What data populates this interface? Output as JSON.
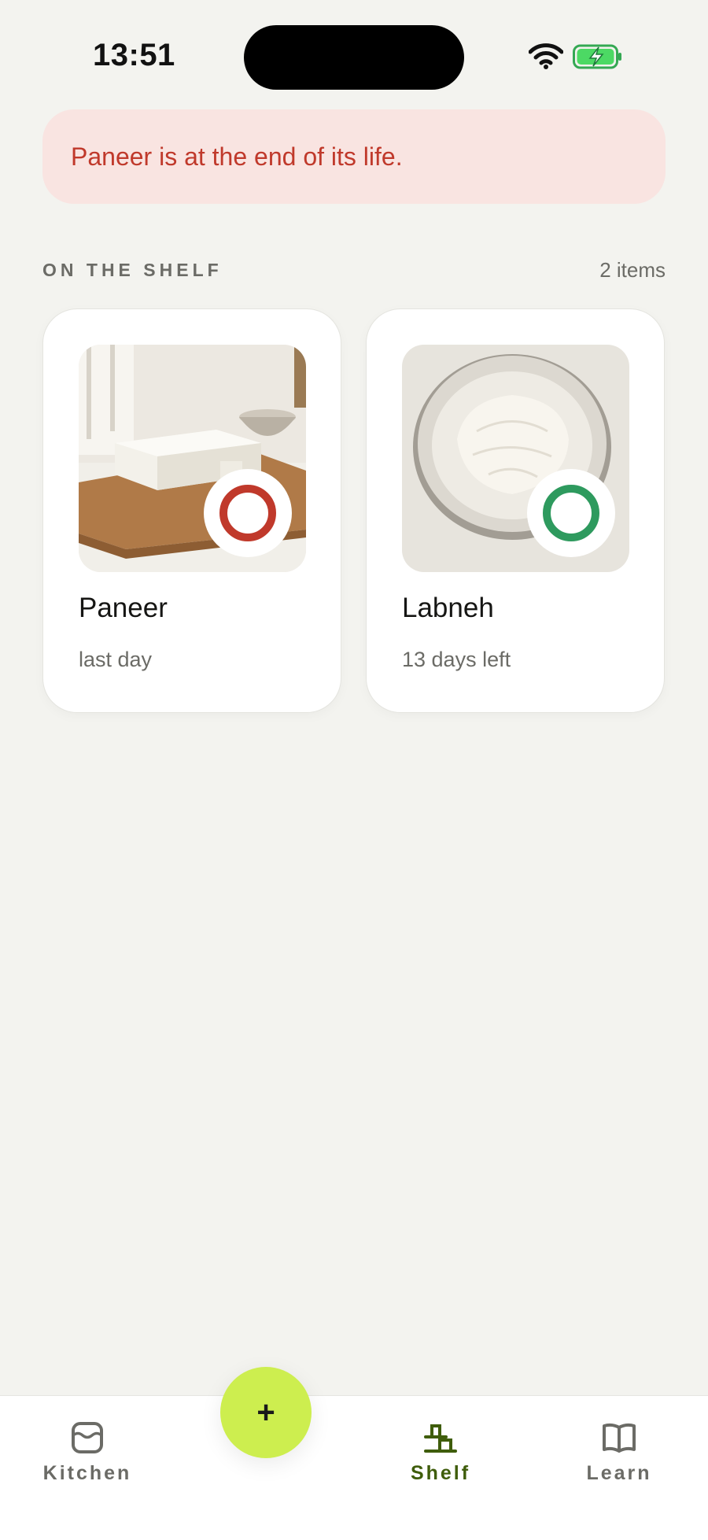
{
  "status_bar": {
    "time": "13:51"
  },
  "alert": {
    "text": "Paneer is at the end of its life.",
    "color": "#c0392b",
    "background": "#f9e4e1"
  },
  "shelf": {
    "title": "ON THE SHELF",
    "count": "2 items",
    "items": [
      {
        "name": "Paneer",
        "status": "last day",
        "status_color": "#c0392b",
        "photo_icon": "paneer-photo"
      },
      {
        "name": "Labneh",
        "status": "13 days left",
        "status_color": "#2e9a5e",
        "photo_icon": "labneh-photo"
      }
    ]
  },
  "tab_bar": {
    "tabs": [
      {
        "label": "Kitchen",
        "icon": "kitchen-icon",
        "active": false
      },
      {
        "label": "Shelf",
        "icon": "shelf-icon",
        "active": true
      },
      {
        "label": "Learn",
        "icon": "book-icon",
        "active": false
      }
    ],
    "fab_label": "+",
    "accent": "#cdee4f",
    "active_color": "#3f5d0b"
  }
}
